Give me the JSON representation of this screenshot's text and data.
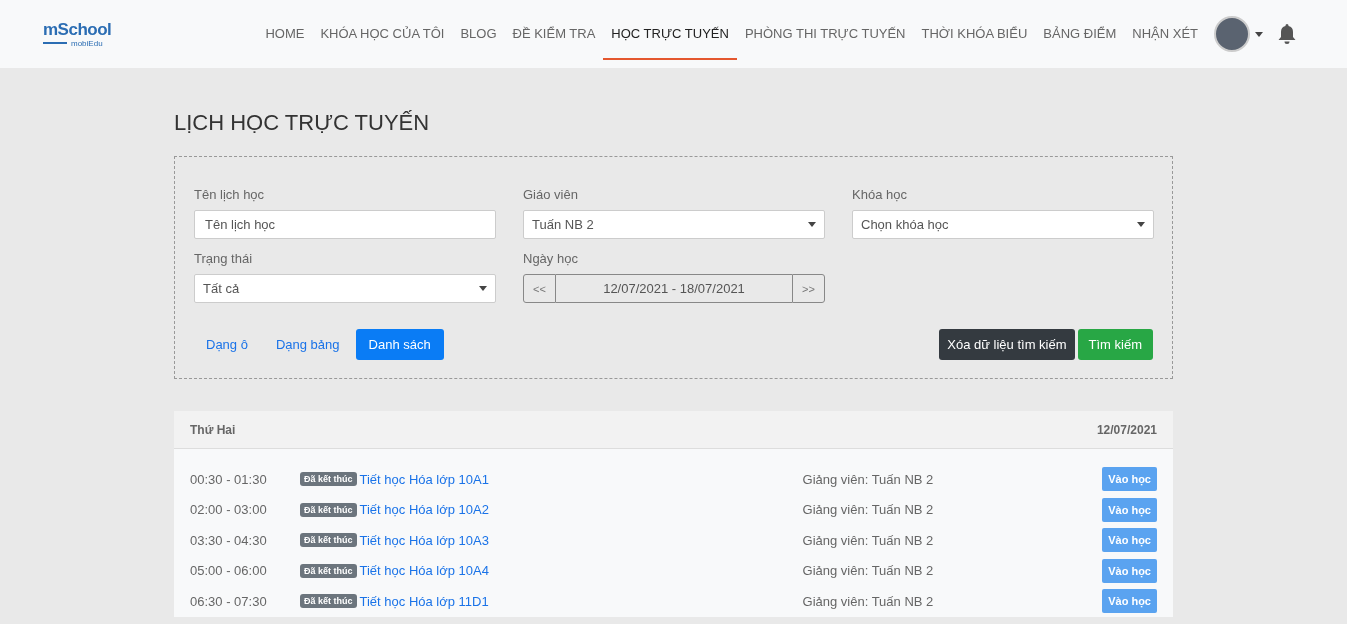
{
  "header": {
    "logo": "mSchool",
    "logo_sub": "mobiEdu",
    "nav": [
      {
        "label": "HOME",
        "selected": false
      },
      {
        "label": "KHÓA HỌC CỦA TÔI",
        "selected": false
      },
      {
        "label": "BLOG",
        "selected": false
      },
      {
        "label": "ĐỀ KIỂM TRA",
        "selected": false
      },
      {
        "label": "HỌC TRỰC TUYẾN",
        "selected": true
      },
      {
        "label": "PHÒNG THI TRỰC TUYẾN",
        "selected": false
      },
      {
        "label": "THỜI KHÓA BIỂU",
        "selected": false
      },
      {
        "label": "BẢNG ĐIỂM",
        "selected": false
      },
      {
        "label": "NHẬN XÉT",
        "selected": false
      }
    ]
  },
  "page_title": "LỊCH HỌC TRỰC TUYẾN",
  "filters": {
    "fields": [
      {
        "kind": "text",
        "label": "Tên lịch học",
        "placeholder": "Tên lịch học"
      },
      {
        "kind": "select",
        "label": "Giáo viên",
        "value": "Tuấn NB 2"
      },
      {
        "kind": "select",
        "label": "Khóa học",
        "value": "Chọn khóa học"
      },
      {
        "kind": "select",
        "label": "Trạng thái",
        "value": "Tất cả"
      },
      {
        "kind": "date",
        "label": "Ngày học",
        "prev": "<<",
        "value": "12/07/2021 - 18/07/2021",
        "next": ">>"
      }
    ],
    "views": [
      {
        "label": "Dạng ô",
        "selected": false
      },
      {
        "label": "Dạng bảng",
        "selected": false
      },
      {
        "label": "Danh sách",
        "selected": true
      }
    ],
    "clear_button": "Xóa dữ liệu tìm kiếm",
    "search_button": "Tìm kiếm"
  },
  "schedule": {
    "day": "Thứ Hai",
    "date": "12/07/2021",
    "rows": [
      {
        "time": "00:30 - 01:30",
        "status": "Đã kết thúc",
        "title": "Tiết học Hóa lớp 10A1",
        "teacher": "Giảng viên: Tuấn NB 2",
        "action": "Vào học"
      },
      {
        "time": "02:00 - 03:00",
        "status": "Đã kết thúc",
        "title": "Tiết học Hóa lớp 10A2",
        "teacher": "Giảng viên: Tuấn NB 2",
        "action": "Vào học"
      },
      {
        "time": "03:30 - 04:30",
        "status": "Đã kết thúc",
        "title": "Tiết học Hóa lớp 10A3",
        "teacher": "Giảng viên: Tuấn NB 2",
        "action": "Vào học"
      },
      {
        "time": "05:00 - 06:00",
        "status": "Đã kết thúc",
        "title": "Tiết học Hóa lớp 10A4",
        "teacher": "Giảng viên: Tuấn NB 2",
        "action": "Vào học"
      },
      {
        "time": "06:30 - 07:30",
        "status": "Đã kết thúc",
        "title": "Tiết học Hóa lớp 11D1",
        "teacher": "Giảng viên: Tuấn NB 2",
        "action": "Vào học"
      }
    ]
  }
}
